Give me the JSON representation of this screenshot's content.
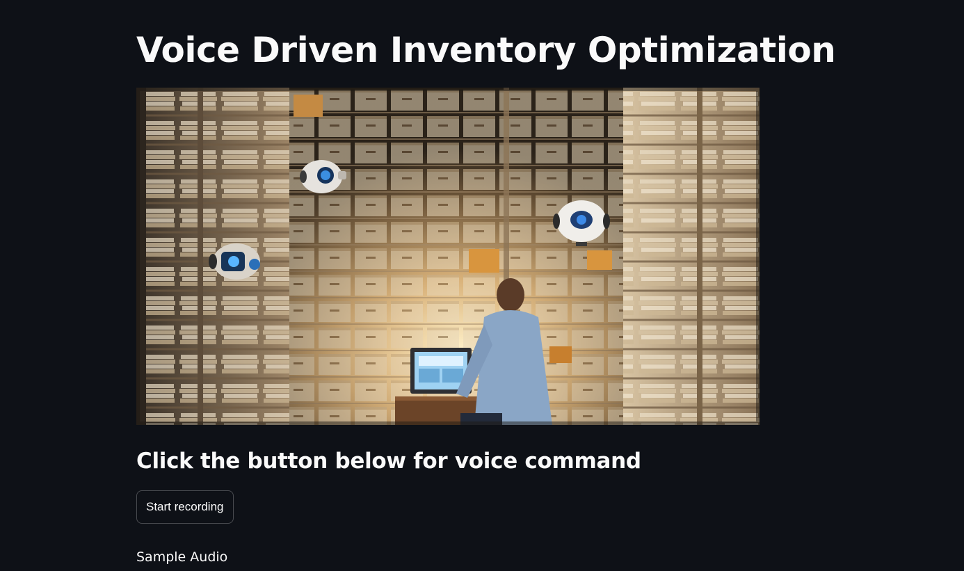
{
  "app": {
    "title": "Voice Driven Inventory Optimization"
  },
  "hero": {
    "image_name": "warehouse-robots-illustration"
  },
  "voice": {
    "heading": "Click the button below for voice command",
    "button_label": "Start recording"
  },
  "sample_audio": {
    "label": "Sample Audio"
  },
  "colors": {
    "background": "#0e1117",
    "text": "#fafafa",
    "button_border": "rgba(250,250,250,0.25)"
  }
}
